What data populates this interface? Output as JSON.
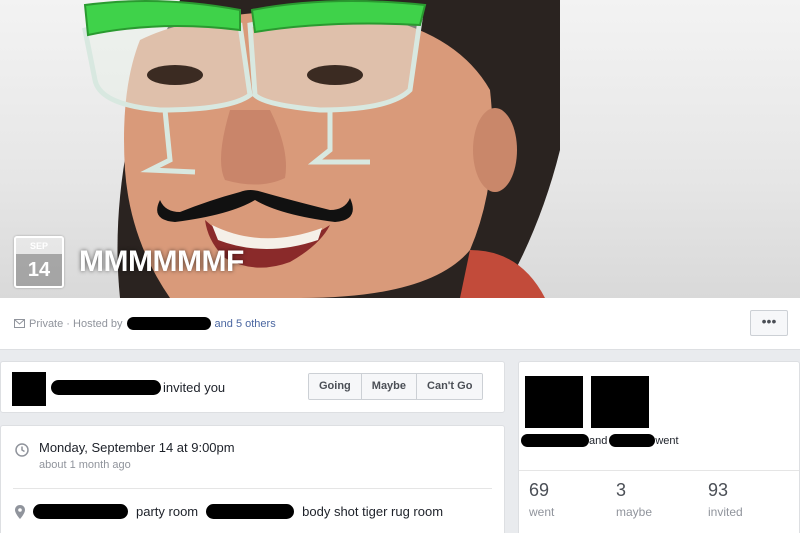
{
  "event": {
    "month": "SEP",
    "day": "14",
    "title": "MMMMMMF"
  },
  "meta": {
    "privacy": "Private · Hosted by",
    "others": "and 5 others",
    "more_label": "•••"
  },
  "invite": {
    "text": "invited you",
    "buttons": [
      "Going",
      "Maybe",
      "Can't Go"
    ]
  },
  "details": {
    "datetime": "Monday, September 14 at 9:00pm",
    "relative": "about 1 month ago",
    "location_part1": "party room",
    "location_part2": "body shot tiger rug room"
  },
  "guests": {
    "names_mid": "and",
    "names_end": "went",
    "stats": [
      {
        "value": "69",
        "label": "went"
      },
      {
        "value": "3",
        "label": "maybe"
      },
      {
        "value": "93",
        "label": "invited"
      }
    ]
  }
}
